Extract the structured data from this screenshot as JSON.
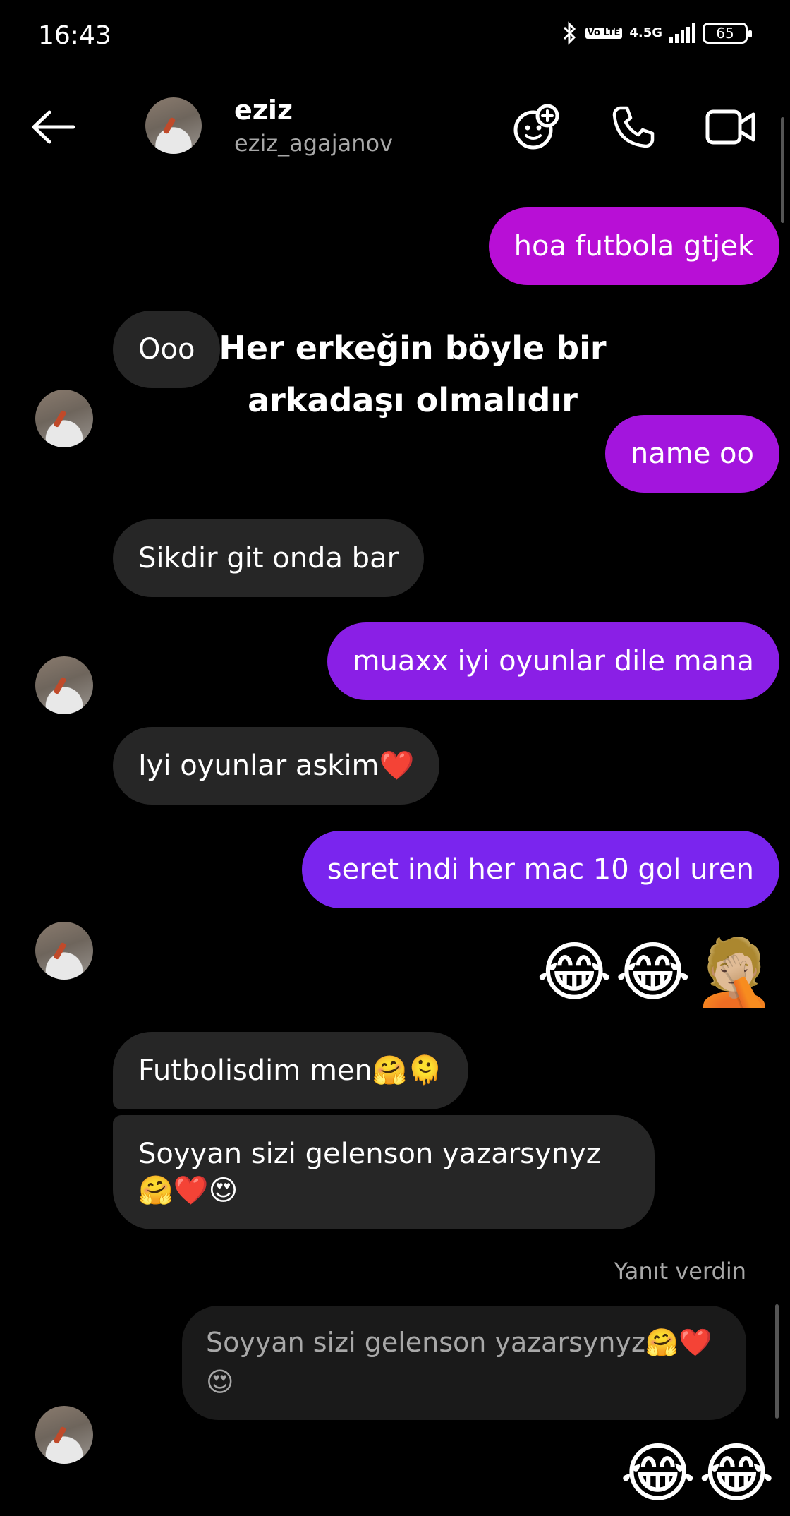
{
  "status_bar": {
    "time": "16:43",
    "network": "4.5G",
    "volte": "Vo LTE",
    "battery": "65",
    "icons": [
      "bluetooth-icon",
      "signal-icon",
      "battery-icon"
    ]
  },
  "header": {
    "name": "eziz",
    "username": "eziz_agajanov",
    "icons": [
      "back-arrow-icon",
      "effects-face-icon",
      "phone-icon",
      "video-camera-icon"
    ]
  },
  "overlay_caption": {
    "line1": "Her erkeğin böyle bir",
    "line2": "arkadaşı olmalıdır"
  },
  "messages": [
    {
      "from": "me",
      "text": "hoa futbola gtjek",
      "color": "#b80fd6"
    },
    {
      "from": "them",
      "text": "Ooo"
    },
    {
      "from": "me",
      "text": "name oo",
      "color": "#a315dd"
    },
    {
      "from": "them",
      "text": "Sikdir git onda bar"
    },
    {
      "from": "me",
      "text": "muaxx iyi oyunlar dile mana",
      "color": "#8a1fe6"
    },
    {
      "from": "them",
      "text": "Iyi oyunlar askim❤️"
    },
    {
      "from": "me",
      "text": "seret indi her mac 10 gol uren",
      "color": "#7a25ee"
    },
    {
      "from": "me",
      "text": "😂😂🤦🏼",
      "type": "emoji"
    },
    {
      "from": "them",
      "text": "Futbolisdim men🤗🫠"
    },
    {
      "from": "them",
      "text_line1": "Soyyan sizi gelenson yazarsynyz",
      "text_line2": "🤗❤️😍"
    },
    {
      "from": "me",
      "text": "😂😂",
      "type": "emoji"
    }
  ],
  "reply": {
    "label": "Yanıt verdin",
    "quoted": "Soyyan sizi gelenson yazarsynyz🤗❤️ 😍"
  }
}
